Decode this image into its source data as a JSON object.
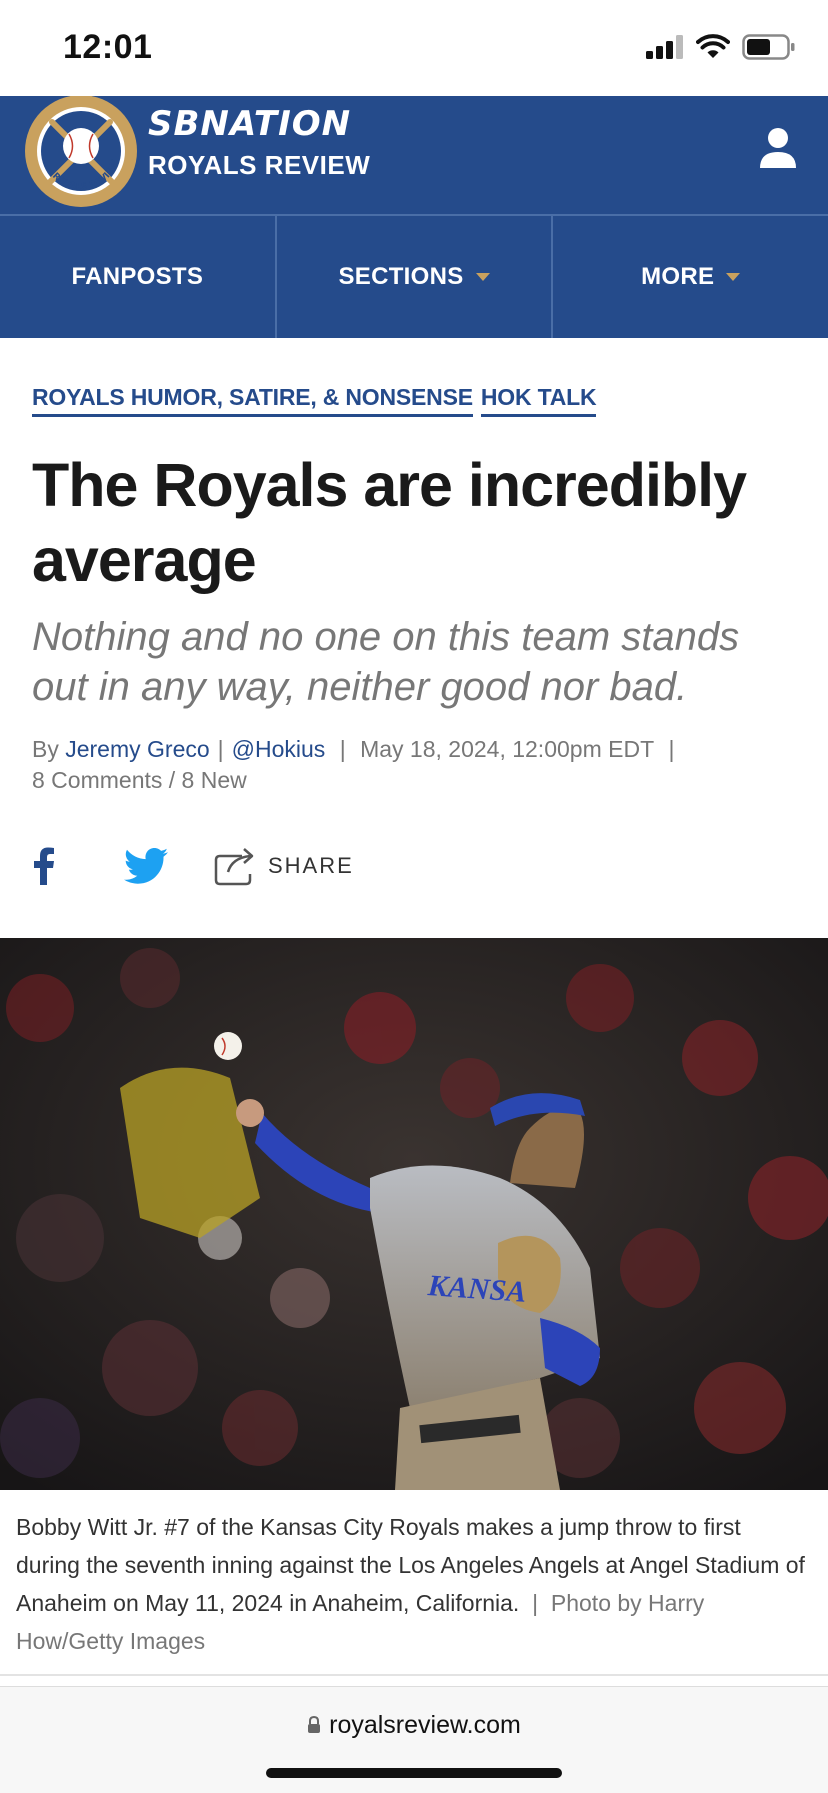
{
  "status": {
    "time": "12:01"
  },
  "masthead": {
    "network": "SBNATION",
    "site": "ROYALS REVIEW",
    "logo_ring_text": "ROYALS REVIEW"
  },
  "nav": {
    "items": [
      "FANPOSTS",
      "SECTIONS",
      "MORE"
    ]
  },
  "article": {
    "categories": [
      "ROYALS HUMOR, SATIRE, & NONSENSE",
      "HOK TALK"
    ],
    "title": "The Royals are incredibly average",
    "dek": "Nothing and no one on this team stands out in any way, neither good nor bad.",
    "byline": {
      "by": "By",
      "author": "Jeremy Greco",
      "handle": "@Hokius",
      "date": "May 18, 2024, 12:00pm EDT",
      "comments": "8 Comments / 8 New"
    },
    "share_label": "SHARE",
    "caption": "Bobby Witt Jr. #7 of the Kansas City Royals makes a jump throw to first during the seventh inning against the Los Angeles Angels at Angel Stadium of Anaheim on May 11, 2024 in Anaheim, California.",
    "credit": "Photo by Harry How/Getty Images",
    "jersey_text": "KANSA"
  },
  "browser": {
    "url": "royalsreview.com"
  },
  "colors": {
    "brand_blue": "#254b8b",
    "gold": "#c9a15e"
  }
}
